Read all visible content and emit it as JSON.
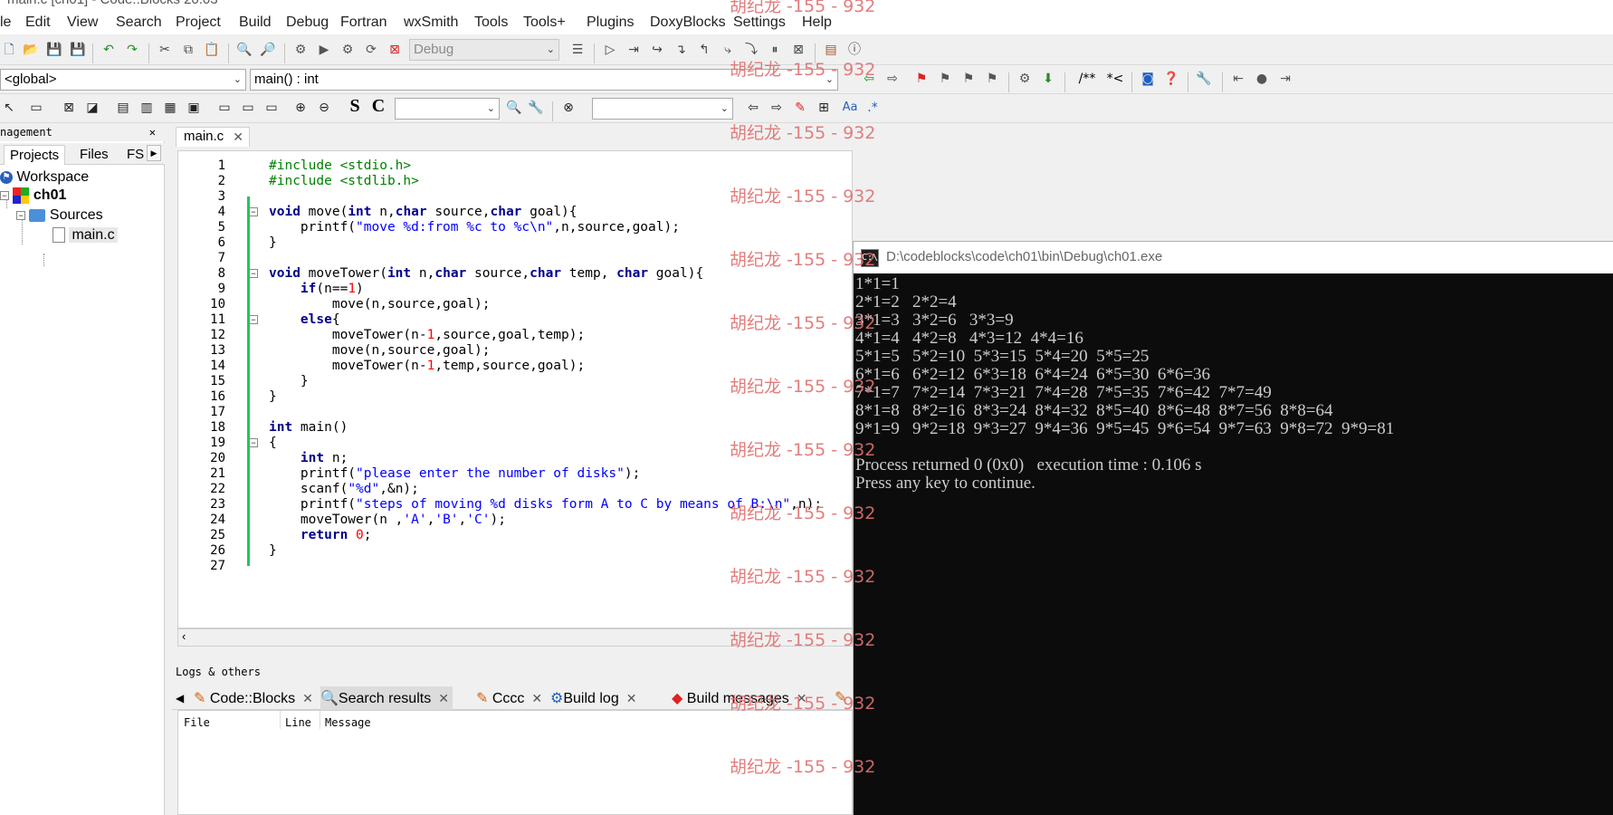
{
  "window": {
    "title": "main.c [ch01] - Code::Blocks 20.03"
  },
  "menu": [
    "le",
    "Edit",
    "View",
    "Search",
    "Project",
    "Build",
    "Debug",
    "Fortran",
    "wxSmith",
    "Tools",
    "Tools+",
    "Plugins",
    "DoxyBlocks",
    "Settings",
    "Help"
  ],
  "toolbar": {
    "build_target": "Debug",
    "scope": "<global>",
    "function": "main() : int",
    "doxy_comment": "/**",
    "doxy_line": "*<",
    "regex": ".*",
    "match_case": "Aa"
  },
  "management": {
    "header": "nagement",
    "tabs": [
      "Projects",
      "Files",
      "FS"
    ],
    "tree": {
      "workspace": "Workspace",
      "project": "ch01",
      "folder": "Sources",
      "file": "main.c"
    }
  },
  "editor": {
    "tab": "main.c",
    "lines": [
      "#include <stdio.h>",
      "#include <stdlib.h>",
      "",
      "void move(int n,char source,char goal){",
      "    printf(\"move %d:from %c to %c\\n\",n,source,goal);",
      "}",
      "",
      "void moveTower(int n,char source,char temp, char goal){",
      "    if(n==1)",
      "        move(n,source,goal);",
      "    else{",
      "        moveTower(n-1,source,goal,temp);",
      "        move(n,source,goal);",
      "        moveTower(n-1,temp,source,goal);",
      "    }",
      "}",
      "",
      "int main()",
      "{",
      "    int n;",
      "    printf(\"please enter the number of disks\");",
      "    scanf(\"%d\",&n);",
      "    printf(\"steps of moving %d disks form A to C by means of B:\\n\",n);",
      "    moveTower(n ,'A','B','C');",
      "    return 0;",
      "}",
      ""
    ],
    "line_numbers": [
      "1",
      "2",
      "3",
      "4",
      "5",
      "6",
      "7",
      "8",
      "9",
      "10",
      "11",
      "12",
      "13",
      "14",
      "15",
      "16",
      "17",
      "18",
      "19",
      "20",
      "21",
      "22",
      "23",
      "24",
      "25",
      "26",
      "27"
    ]
  },
  "logs": {
    "header": "Logs & others",
    "tabs": [
      "Code::Blocks",
      "Search results",
      "Cccc",
      "Build log",
      "Build messages"
    ],
    "columns": [
      "File",
      "Line",
      "Message"
    ]
  },
  "console": {
    "title": "D:\\codeblocks\\code\\ch01\\bin\\Debug\\ch01.exe",
    "lines": [
      "1*1=1",
      "2*1=2   2*2=4",
      "3*1=3   3*2=6   3*3=9",
      "4*1=4   4*2=8   4*3=12  4*4=16",
      "5*1=5   5*2=10  5*3=15  5*4=20  5*5=25",
      "6*1=6   6*2=12  6*3=18  6*4=24  6*5=30  6*6=36",
      "7*1=7   7*2=14  7*3=21  7*4=28  7*5=35  7*6=42  7*7=49",
      "8*1=8   8*2=16  8*3=24  8*4=32  8*5=40  8*6=48  8*7=56  8*8=64",
      "9*1=9   9*2=18  9*3=27  9*4=36  9*5=45  9*6=54  9*7=63  9*8=72  9*9=81",
      "",
      "Process returned 0 (0x0)   execution time : 0.106 s",
      "Press any key to continue."
    ]
  },
  "watermark": "胡纪龙 -155 - 932",
  "colors": {
    "keyword": "#00008b",
    "string": "#0000ff",
    "preprocessor": "#008000",
    "number": "#ff0000",
    "watermark": "#e07070"
  }
}
